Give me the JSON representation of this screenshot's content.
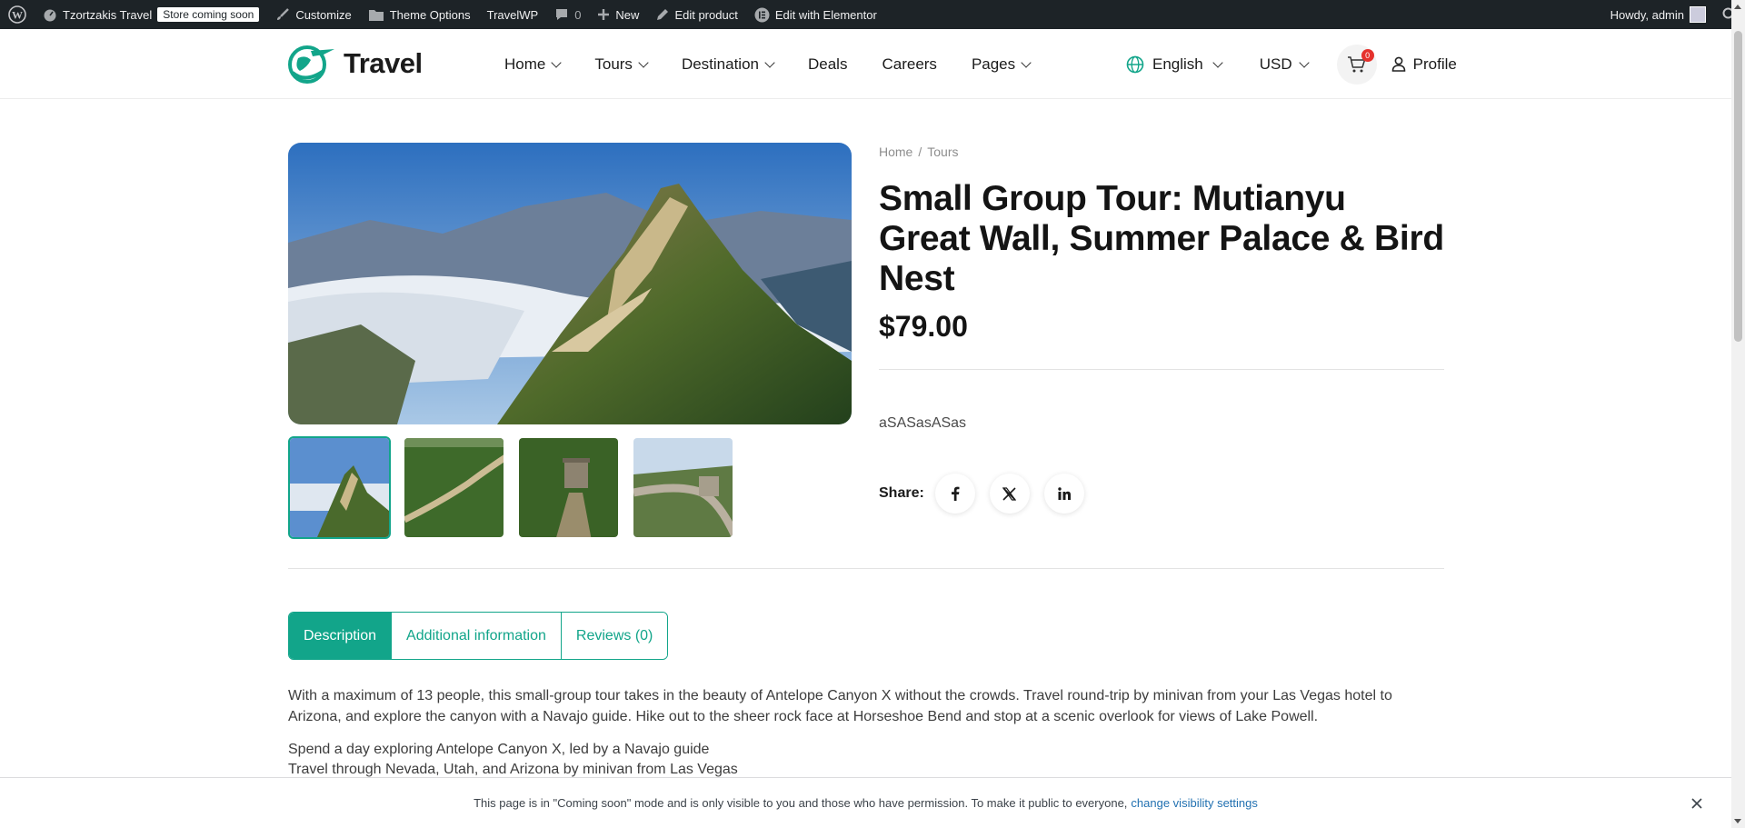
{
  "admin_bar": {
    "site_name": "Tzortzakis Travel",
    "store_badge": "Store coming soon",
    "customize": "Customize",
    "theme_options": "Theme Options",
    "travelwp": "TravelWP",
    "comments_count": "0",
    "new": "New",
    "edit_product": "Edit product",
    "edit_elementor": "Edit with Elementor",
    "howdy": "Howdy, admin"
  },
  "header": {
    "logo_text": "Travel",
    "nav": [
      "Home",
      "Tours",
      "Destination",
      "Deals",
      "Careers",
      "Pages"
    ],
    "language": "English",
    "currency": "USD",
    "cart_count": "0",
    "profile": "Profile"
  },
  "product": {
    "breadcrumb": [
      "Home",
      "/",
      "Tours"
    ],
    "title": "Small Group Tour: Mutianyu Great Wall, Summer Palace & Bird Nest",
    "price": "$79.00",
    "short_description": "aSASasASas",
    "share_label": "Share:"
  },
  "tabs": [
    "Description",
    "Additional information",
    "Reviews (0)"
  ],
  "description": {
    "paragraph": "With a maximum of 13 people, this small-group tour takes in the beauty of Antelope Canyon X without the crowds. Travel round-trip by minivan from your Las Vegas hotel to Arizona, and explore the canyon with a Navajo guide. Hike out to the sheer rock face at Horseshoe Bend and stop at a scenic overlook for views of Lake Powell.",
    "lines": [
      "Spend a day exploring Antelope Canyon X, led by a Navajo guide",
      "Travel through Nevada, Utah, and Arizona by minivan from Las Vegas"
    ]
  },
  "notice": {
    "text": "This page is in \"Coming soon\" mode and is only visible to you and those who have permission. To make it public to everyone,",
    "link": "change visibility settings"
  },
  "colors": {
    "accent": "#12a58a",
    "admin_bar": "#1d2327",
    "badge": "#e5322d"
  }
}
